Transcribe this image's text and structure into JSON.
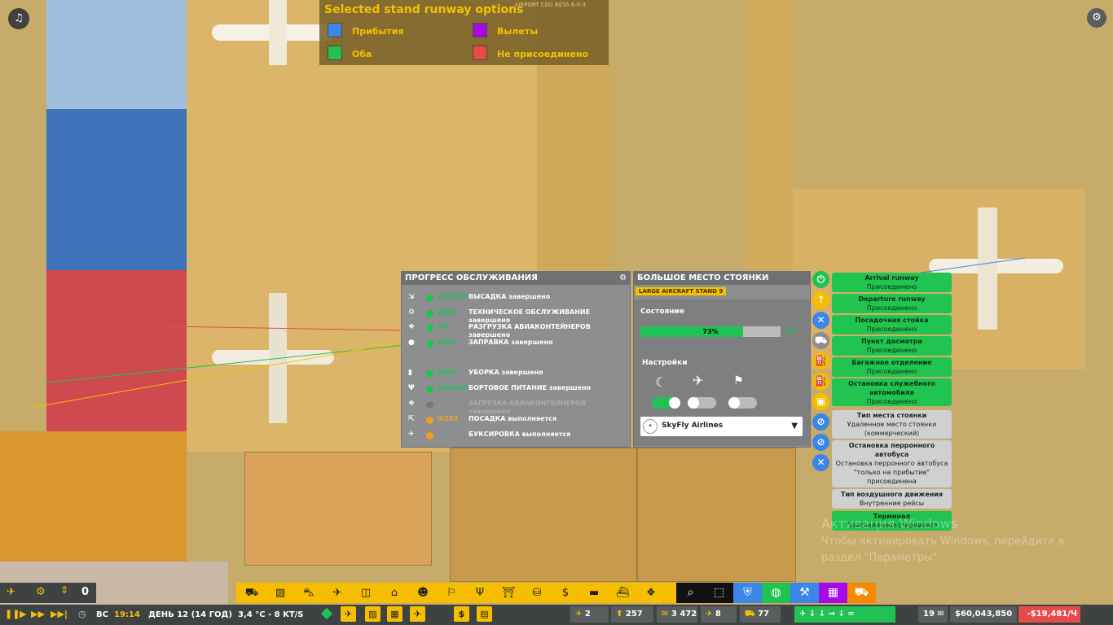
{
  "legend": {
    "title": "Selected stand runway options",
    "version": "AIRPORT CEO BETA 6.0-3",
    "items": [
      {
        "label": "Прибытия",
        "color": "#3b86e8"
      },
      {
        "label": "Вылеты",
        "color": "#a40ae8"
      },
      {
        "label": "Оба",
        "color": "#22c154"
      },
      {
        "label": "Не присоединено",
        "color": "#e84b4b"
      }
    ]
  },
  "service_panel": {
    "title": "ПРОГРЕСС ОБСЛУЖИВАНИЯ",
    "rows": [
      {
        "icon": "deboard-icon",
        "glyph": "⇲",
        "value": "253/253",
        "status": "done",
        "label": "ВЫСАДКА завершено"
      },
      {
        "icon": "maintenance-icon",
        "glyph": "⚙",
        "value": "100%",
        "status": "done",
        "label": "ТЕХНИЧЕСКОЕ ОБСЛУЖИВАНИЕ завершено"
      },
      {
        "icon": "container-unload-icon",
        "glyph": "❖",
        "value": "5/5",
        "status": "done",
        "label": "РАЗГРУЗКА АВИАКОНТЕЙНЕРОВ завершено"
      },
      {
        "icon": "fuel-icon",
        "glyph": "●",
        "value": "100%",
        "status": "done",
        "label": "ЗАПРАВКА завершено"
      },
      {
        "icon": "cleaning-icon",
        "glyph": "▮",
        "value": "100%",
        "status": "done",
        "label": "УБОРКА завершено"
      },
      {
        "icon": "catering-icon",
        "glyph": "Ψ",
        "value": "253/253",
        "status": "done",
        "label": "БОРТОВОЕ ПИТАНИЕ завершено"
      },
      {
        "icon": "container-load-icon",
        "glyph": "❖",
        "value": "",
        "status": "idle",
        "label": "ЗАГРУЗКА АВИАКОНТЕЙНЕРОВ завершено"
      },
      {
        "icon": "boarding-icon",
        "glyph": "⇱",
        "value": "0/253",
        "status": "progress",
        "label": "ПОСАДКА выполняется"
      },
      {
        "icon": "pushback-icon",
        "glyph": "✈",
        "value": "",
        "status": "progress",
        "label": "БУКСИРОВКА выполняется"
      }
    ]
  },
  "stand_panel": {
    "title": "БОЛЬШОЕ МЕСТО СТОЯНКИ",
    "stand_name": "LARGE AIRCRAFT STAND 9",
    "condition_label": "Состояние",
    "condition_value": "73%",
    "condition_fraction": 0.73,
    "settings_label": "Настройки",
    "toggles": [
      {
        "icon": "night-icon",
        "glyph": "☾",
        "on": true
      },
      {
        "icon": "aircraft-icon",
        "glyph": "✈",
        "on": false
      },
      {
        "icon": "baggage-icon",
        "glyph": "⚑",
        "on": false
      }
    ],
    "airline": "SkyFly Airlines"
  },
  "side_buttons": [
    {
      "icon": "power-icon",
      "glyph": "⏻",
      "color": "#22c154"
    },
    {
      "icon": "arrow-up-icon",
      "glyph": "↑",
      "color": "#f5be00"
    },
    {
      "icon": "wrench-icon",
      "glyph": "✕",
      "color": "#3b86e8"
    },
    {
      "icon": "vehicle-icon",
      "glyph": "⛟",
      "color": "#8c8e90"
    },
    {
      "icon": "fuel-truck-icon",
      "glyph": "⛽",
      "color": "#f5be00"
    },
    {
      "icon": "fuel-small-icon",
      "glyph": "⛽",
      "color": "#f5be00"
    },
    {
      "icon": "briefcase-icon",
      "glyph": "▣",
      "color": "#f5be00"
    },
    {
      "icon": "no-bus-icon",
      "glyph": "⊘",
      "color": "#3b86e8"
    },
    {
      "icon": "no-bus-2-icon",
      "glyph": "⊘",
      "color": "#3b86e8"
    },
    {
      "icon": "cancel-icon",
      "glyph": "✕",
      "color": "#3b86e8"
    }
  ],
  "stand_options": [
    {
      "title": "Arrival runway",
      "value": "Присоединено",
      "style": "green"
    },
    {
      "title": "Departure runway",
      "value": "Присоединено",
      "style": "green"
    },
    {
      "title": "Посадочная стойка",
      "value": "Присоединено",
      "style": "green"
    },
    {
      "title": "Пункт досмотра",
      "value": "Присоединено",
      "style": "green"
    },
    {
      "title": "Багажное отделение",
      "value": "Присоединено",
      "style": "green"
    },
    {
      "title": "Остановка служебного автомобиля",
      "value": "Присоединено",
      "style": "green"
    },
    {
      "title": "Тип места стоянки",
      "value": "Удаленное место стоянки (коммерческий)",
      "style": "grey"
    },
    {
      "title": "Остановка перронного автобуса",
      "value": "Остановка перронного автобуса \"только на прибытие\" присоединена",
      "style": "grey"
    },
    {
      "title": "Тип воздушного движения",
      "value": "Внутренние рейсы",
      "style": "grey"
    },
    {
      "title": "Терминал",
      "value": "Присоединено (терминал)",
      "style": "green"
    }
  ],
  "watermark": {
    "line1": "Активация Windows",
    "line2": "Чтобы активировать Windows, перейдите в",
    "line3": "раздел \"Параметры\"."
  },
  "toolbar": {
    "icons": [
      "runway-icon",
      "taxiway-icon",
      "bus-icon",
      "atc-icon",
      "luggage-icon",
      "terminal-icon",
      "passengers-icon",
      "security-icon",
      "food-icon",
      "gate-icon",
      "shop-icon",
      "money-icon",
      "vehicles-icon",
      "cargo-icon",
      "boxes-icon"
    ],
    "glyphs": [
      "⛟",
      "▨",
      "⛍",
      "✈",
      "◫",
      "⌂",
      "☻",
      "⚐",
      "Ψ",
      "⛩",
      "⛁",
      "$",
      "▬",
      "⛴",
      "❖"
    ],
    "tools": [
      {
        "icon": "search-icon",
        "glyph": "⌕",
        "color": "#111"
      },
      {
        "icon": "select-icon",
        "glyph": "⬚",
        "color": "#111"
      },
      {
        "icon": "shield-icon",
        "glyph": "⛨",
        "color": "#3b86e8"
      },
      {
        "icon": "world-icon",
        "glyph": "◍",
        "color": "#22c154"
      },
      {
        "icon": "blueprint-icon",
        "glyph": "⚒",
        "color": "#3b86e8"
      },
      {
        "icon": "zones-icon",
        "glyph": "▦",
        "color": "#a40ae8"
      },
      {
        "icon": "vehicle-tool-icon",
        "glyph": "⛟",
        "color": "#f58a00"
      }
    ]
  },
  "bottom_bar": {
    "day_name": "ВС",
    "time": "19:14",
    "day": "ДЕНЬ 12 (14 ГОД)",
    "weather": "3,4 °C - 8 KT/S",
    "stats": [
      {
        "icon": "flights-icon",
        "value": "2 991"
      },
      {
        "icon": "passenger-icon",
        "value": "257"
      },
      {
        "icon": "staff-icon",
        "value": "3 472"
      },
      {
        "icon": "aircraft-count-icon",
        "value": "8"
      },
      {
        "icon": "vehicles-count-icon",
        "value": "77"
      }
    ],
    "mail_count": "19",
    "money": "$60,043,850",
    "income": "-$19,481/Ч",
    "notif_count": "0"
  }
}
